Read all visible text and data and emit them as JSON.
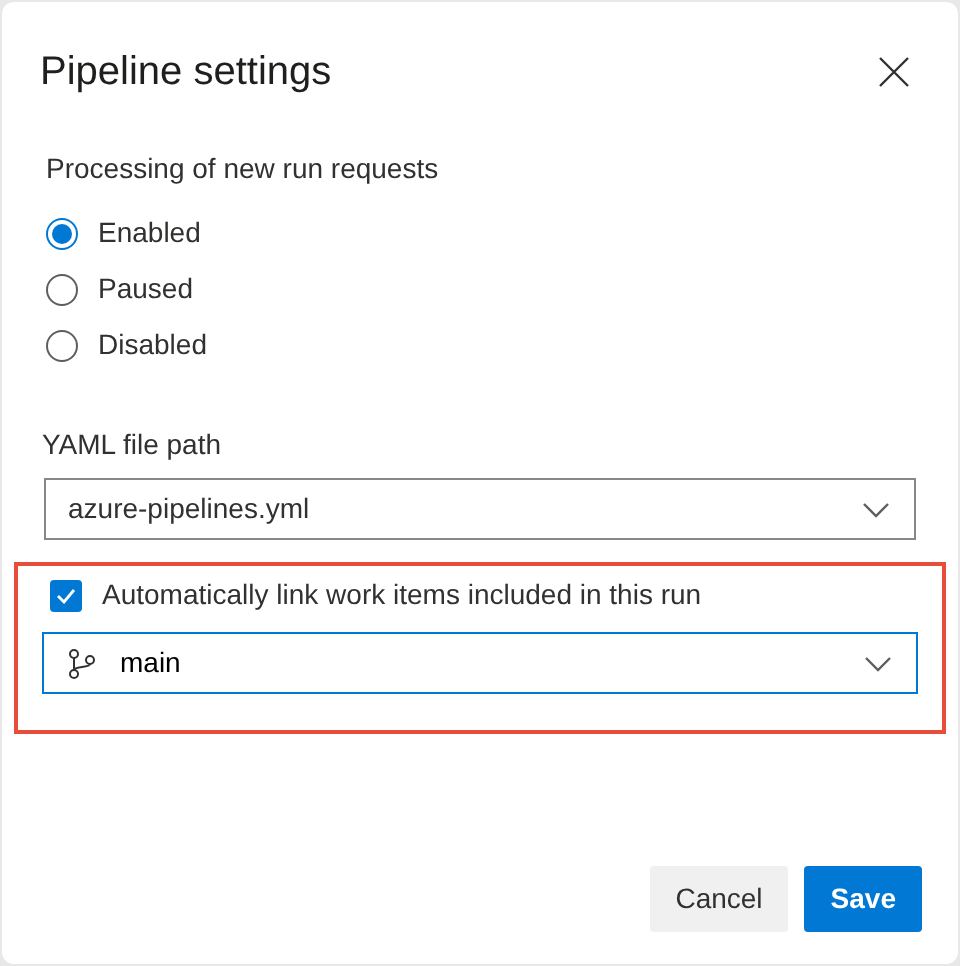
{
  "dialog": {
    "title": "Pipeline settings"
  },
  "processing": {
    "label": "Processing of new run requests",
    "options": [
      {
        "label": "Enabled",
        "selected": true
      },
      {
        "label": "Paused",
        "selected": false
      },
      {
        "label": "Disabled",
        "selected": false
      }
    ]
  },
  "yaml": {
    "label": "YAML file path",
    "value": "azure-pipelines.yml"
  },
  "link_work_items": {
    "label": "Automatically link work items included in this run",
    "checked": true,
    "highlighted": true
  },
  "branch": {
    "value": "main"
  },
  "buttons": [
    {
      "label": "Cancel",
      "kind": "secondary"
    },
    {
      "label": "Save",
      "kind": "primary"
    }
  ]
}
